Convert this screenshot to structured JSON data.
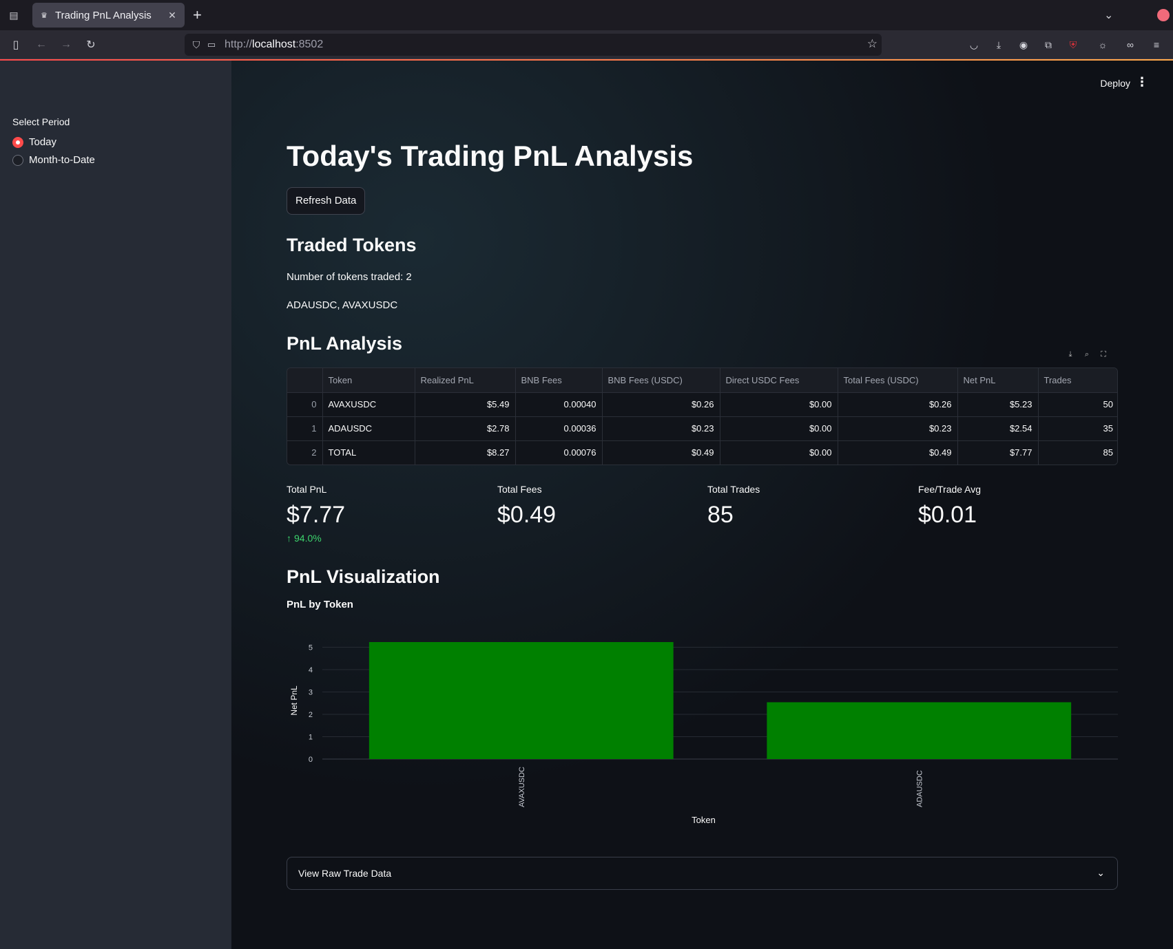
{
  "browser": {
    "tab_title": "Trading PnL Analysis",
    "url_prefix": "http://",
    "url_host": "localhost",
    "url_suffix": ":8502"
  },
  "header": {
    "deploy_label": "Deploy"
  },
  "sidebar": {
    "period_label": "Select Period",
    "options": [
      {
        "label": "Today",
        "selected": true
      },
      {
        "label": "Month-to-Date",
        "selected": false
      }
    ]
  },
  "main": {
    "title": "Today's Trading PnL Analysis",
    "refresh_label": "Refresh Data",
    "traded_tokens_heading": "Traded Tokens",
    "tokens_count_text": "Number of tokens traded: 2",
    "tokens_list_text": "ADAUSDC, AVAXUSDC",
    "pnl_heading": "PnL Analysis",
    "viz_heading": "PnL Visualization",
    "expander_label": "View Raw Trade Data"
  },
  "table": {
    "columns": [
      "",
      "Token",
      "Realized PnL",
      "BNB Fees",
      "BNB Fees (USDC)",
      "Direct USDC Fees",
      "Total Fees (USDC)",
      "Net PnL",
      "Trades"
    ],
    "rows": [
      [
        "0",
        "AVAXUSDC",
        "$5.49",
        "0.00040",
        "$0.26",
        "$0.00",
        "$0.26",
        "$5.23",
        "50"
      ],
      [
        "1",
        "ADAUSDC",
        "$2.78",
        "0.00036",
        "$0.23",
        "$0.00",
        "$0.23",
        "$2.54",
        "35"
      ],
      [
        "2",
        "TOTAL",
        "$8.27",
        "0.00076",
        "$0.49",
        "$0.00",
        "$0.49",
        "$7.77",
        "85"
      ]
    ]
  },
  "metrics": {
    "total_pnl": {
      "label": "Total PnL",
      "value": "$7.77",
      "delta": "94.0%"
    },
    "total_fees": {
      "label": "Total Fees",
      "value": "$0.49"
    },
    "total_trades": {
      "label": "Total Trades",
      "value": "85"
    },
    "fee_trade_avg": {
      "label": "Fee/Trade Avg",
      "value": "$0.01"
    }
  },
  "chart_data": {
    "type": "bar",
    "title": "PnL by Token",
    "xlabel": "Token",
    "ylabel": "Net PnL",
    "categories": [
      "AVAXUSDC",
      "ADAUSDC"
    ],
    "values": [
      5.23,
      2.54
    ],
    "yticks": [
      0,
      1,
      2,
      3,
      4,
      5
    ],
    "ylim": [
      0,
      5.23
    ],
    "grid": true,
    "bar_color": "#008000"
  },
  "colors": {
    "accent": "#ff4b4b",
    "delta_positive": "#3dd56d"
  }
}
